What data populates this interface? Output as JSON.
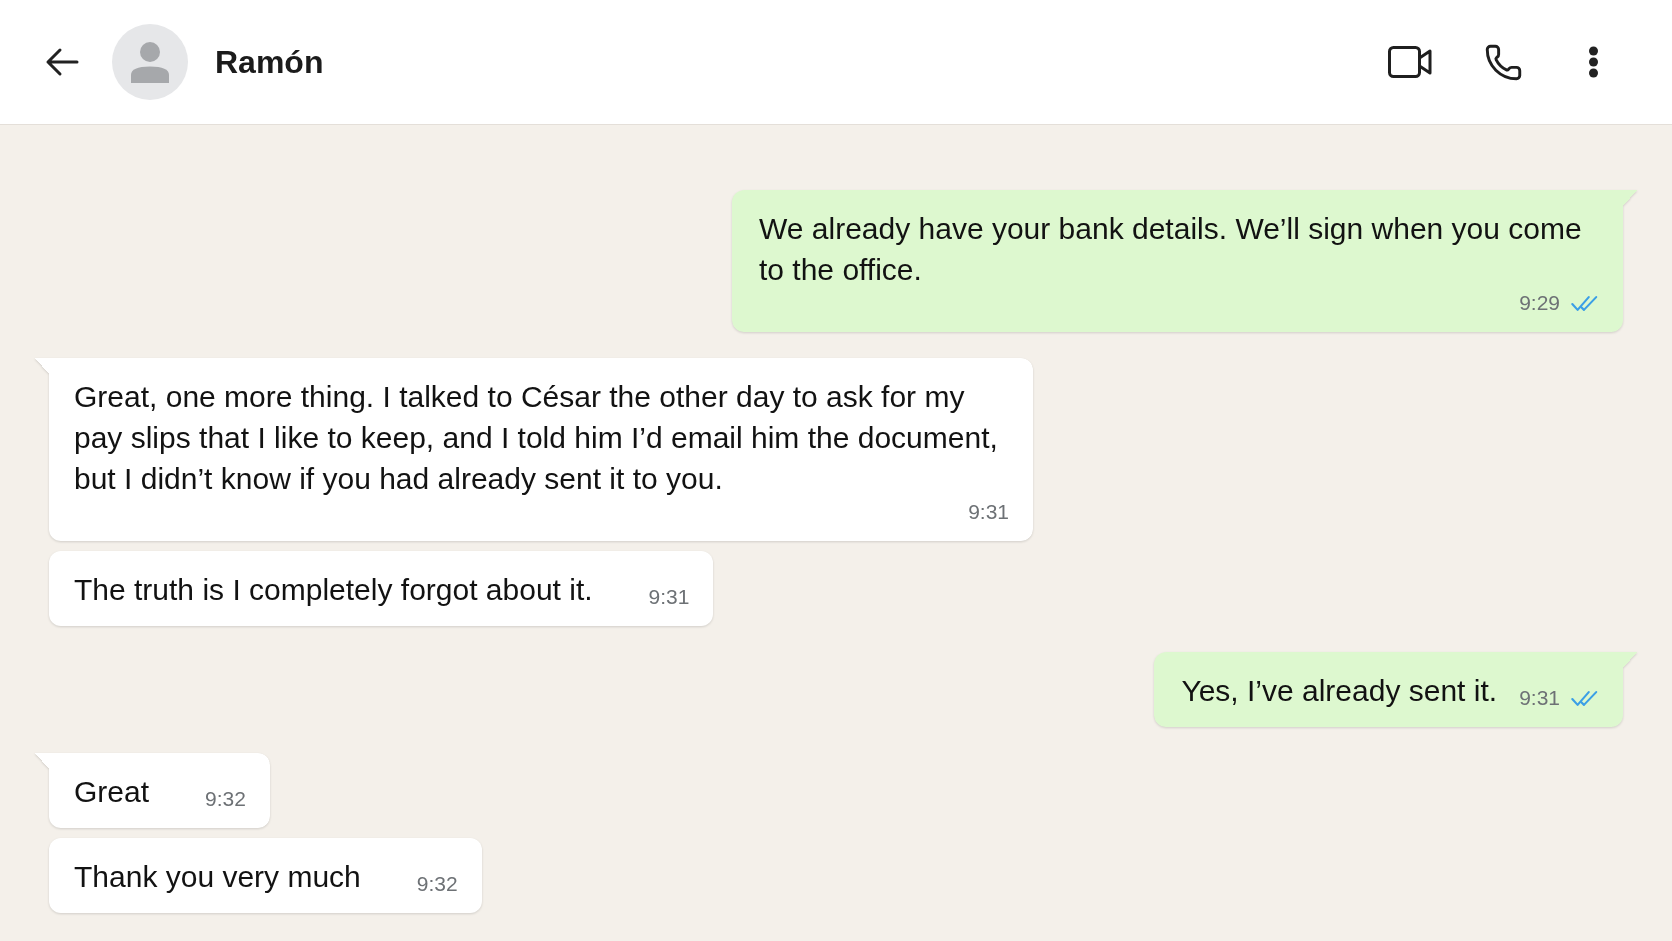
{
  "header": {
    "contact_name": "Ramón"
  },
  "messages": [
    {
      "kind": "outgoing",
      "tail": true,
      "text": "We already have your bank details. We’ll sign when you come to the office.",
      "time": "9:29",
      "read": true
    },
    {
      "kind": "incoming",
      "tail": true,
      "text": "Great, one more thing. I talked to César the other day to ask for my pay slips that I like to keep, and I told him I’d email him the document, but I didn’t know if you had already sent it to you.",
      "time": "9:31"
    },
    {
      "kind": "incoming",
      "tail": false,
      "text": "The truth is I completely forgot about it.",
      "time": "9:31"
    },
    {
      "kind": "outgoing",
      "tail": true,
      "text": "Yes, I’ve already sent it.",
      "time": "9:31",
      "read": true
    },
    {
      "kind": "incoming",
      "tail": true,
      "text": "Great",
      "time": "9:32"
    },
    {
      "kind": "incoming",
      "tail": false,
      "text": "Thank you very much",
      "time": "9:32"
    }
  ]
}
